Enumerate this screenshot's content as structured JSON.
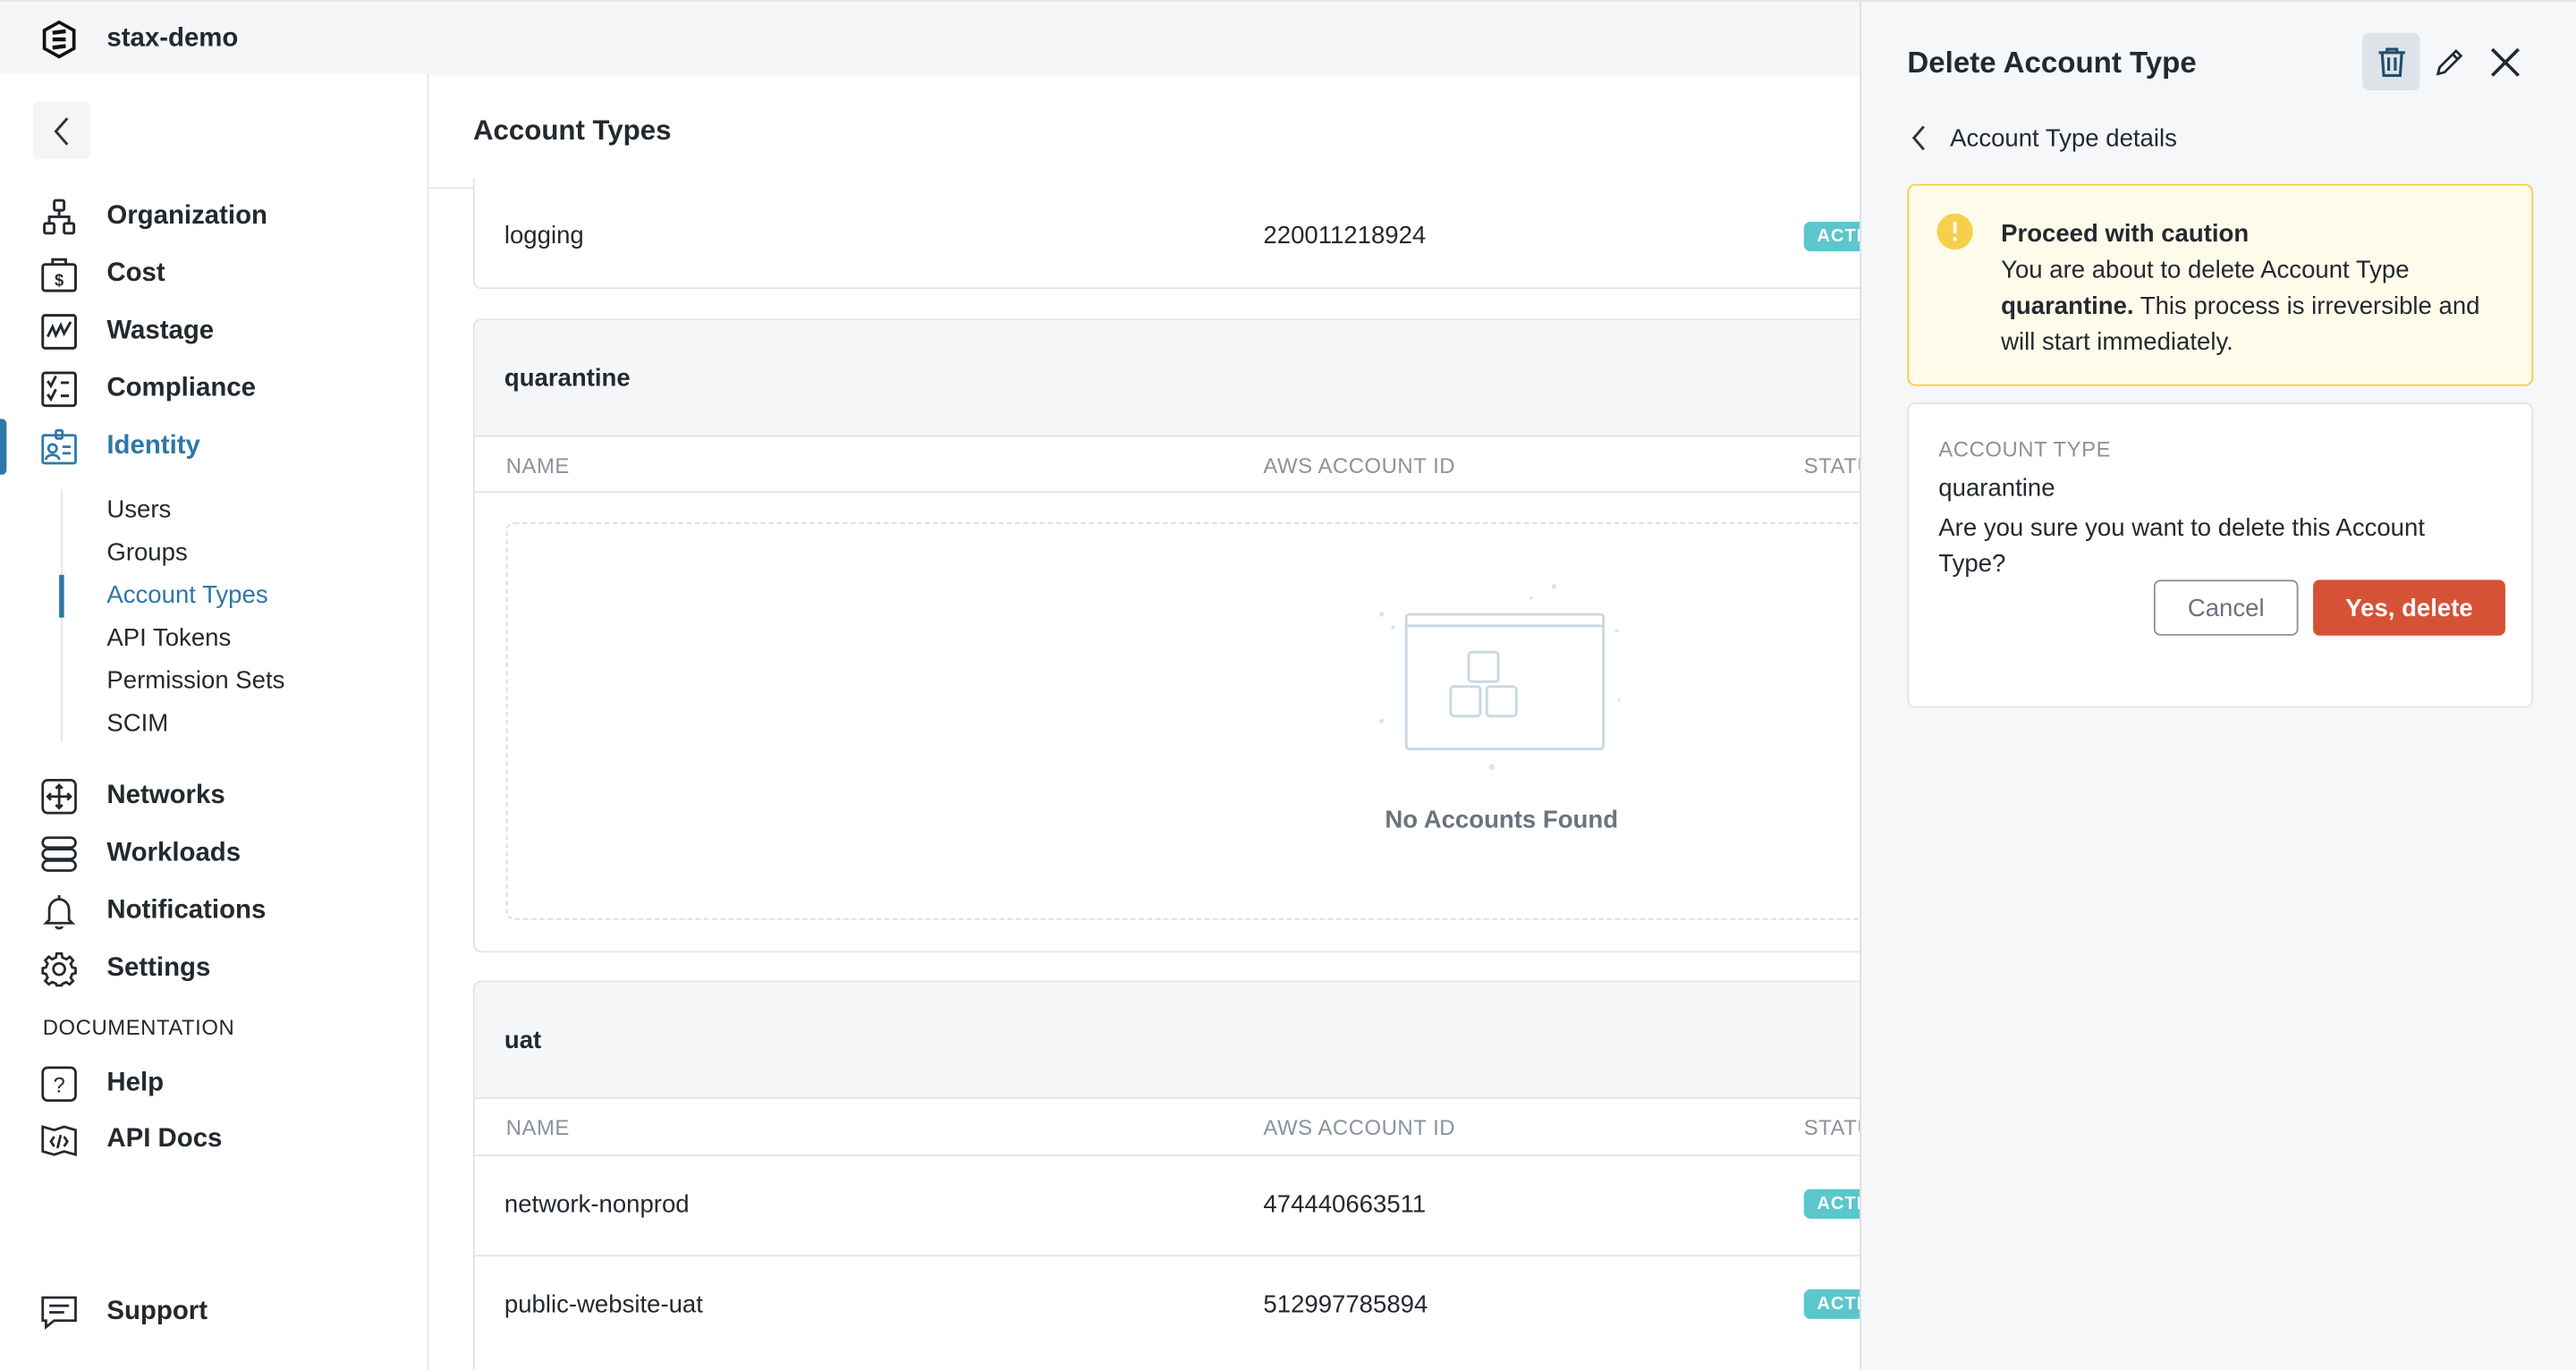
{
  "app": {
    "org_name": "stax-demo"
  },
  "sidebar": {
    "items": [
      {
        "label": "Organization",
        "icon": "organization-icon"
      },
      {
        "label": "Cost",
        "icon": "cost-icon"
      },
      {
        "label": "Wastage",
        "icon": "wastage-icon"
      },
      {
        "label": "Compliance",
        "icon": "compliance-icon"
      },
      {
        "label": "Identity",
        "icon": "identity-icon",
        "active": true
      },
      {
        "label": "Networks",
        "icon": "networks-icon"
      },
      {
        "label": "Workloads",
        "icon": "workloads-icon"
      },
      {
        "label": "Notifications",
        "icon": "bell-icon"
      },
      {
        "label": "Settings",
        "icon": "gear-icon"
      }
    ],
    "identity_sub": [
      "Users",
      "Groups",
      "Account Types",
      "API Tokens",
      "Permission Sets",
      "SCIM"
    ],
    "active_sub": "Account Types",
    "documentation_heading": "DOCUMENTATION",
    "docs": [
      {
        "label": "Help",
        "icon": "help-icon"
      },
      {
        "label": "API Docs",
        "icon": "api-docs-icon"
      }
    ],
    "support": "Support",
    "accent": "#2e77a8"
  },
  "main": {
    "title": "Account Types",
    "columns": [
      "NAME",
      "AWS ACCOUNT ID",
      "STATUS"
    ],
    "logging_row": {
      "name": "logging",
      "id": "220011218924",
      "status": "ACTIVE"
    },
    "groups": [
      {
        "title": "quarantine",
        "empty_text": "No Accounts Found",
        "rows": []
      },
      {
        "title": "uat",
        "rows": [
          {
            "name": "network-nonprod",
            "id": "474440663511",
            "status": "ACTIVE"
          },
          {
            "name": "public-website-uat",
            "id": "512997785894",
            "status": "ACTIVE"
          }
        ]
      }
    ],
    "status_color": "#5bc7cc"
  },
  "panel": {
    "title": "Delete Account Type",
    "back_label": "Account Type details",
    "warning": {
      "title": "Proceed with caution",
      "text_before": "You are about to delete Account Type ",
      "bold_name": "quarantine.",
      "text_after": " This process is irreversible and will start immediately.",
      "color": "#f5cd47"
    },
    "confirm": {
      "label": "ACCOUNT TYPE",
      "value": "quarantine",
      "question": "Are you sure you want to delete this Account Type?",
      "cancel": "Cancel",
      "delete": "Yes, delete",
      "delete_color": "#d65236"
    }
  }
}
